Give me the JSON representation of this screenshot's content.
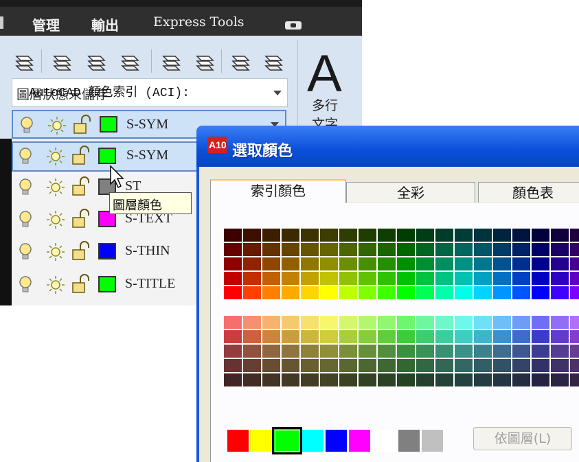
{
  "ribbon": {
    "tabs": [
      "管理",
      "輸出",
      "Express Tools"
    ],
    "layer_state": "圖層狀態未儲存",
    "current_layer": "S-SYM",
    "text_tool": {
      "glyph": "A",
      "label_line1": "多行",
      "label_line2": "文字"
    }
  },
  "layer_list": {
    "rows": [
      {
        "name": "S-SYM",
        "color": "#00ff00"
      },
      {
        "name": "ST",
        "color": "#808080"
      },
      {
        "name": "S-TEXT",
        "color": "#ff00ff"
      },
      {
        "name": "S-THIN",
        "color": "#0000ff"
      },
      {
        "name": "S-TITLE",
        "color": "#00ff00"
      }
    ],
    "tooltip": "圖層顏色"
  },
  "dialog": {
    "app_icon_text": "A10",
    "title": "選取顏色",
    "tabs": [
      "索引顏色",
      "全彩",
      "顏色表"
    ],
    "aci_label": "AutoCAD 顏色索引 (ACI):",
    "standard_colors": [
      "#ff0000",
      "#ffff00",
      "#00ff00",
      "#00ffff",
      "#0000ff",
      "#ff00ff",
      "#ffffff",
      "#808080",
      "#c0c0c0"
    ],
    "selected_standard_index": 2,
    "bylayer_button": "依圖層(L)"
  },
  "colors": {
    "ribbon_bg": "#2f2f2f",
    "panel_bg": "#d9e4f2",
    "selection": "#cde1f7",
    "titlebar": "#0a4fd8"
  }
}
